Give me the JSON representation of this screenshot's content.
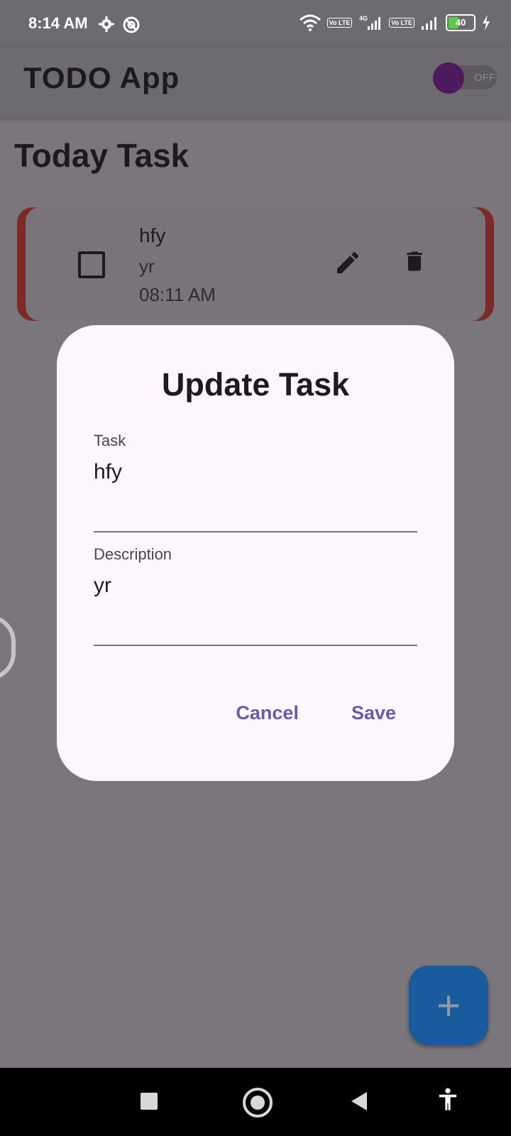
{
  "status_bar": {
    "time": "8:14 AM",
    "icons_left": [
      "gear-icon",
      "target-icon"
    ],
    "network_badge_1": "Vo LTE",
    "network_type": "4G",
    "network_badge_2": "Vo LTE",
    "battery_level": "40",
    "charging_icon": "bolt-icon"
  },
  "app_bar": {
    "title": "TODO App",
    "toggle_label": "OFF",
    "toggle_state": "off"
  },
  "main": {
    "section_title": "Today Task",
    "task": {
      "title": "hfy",
      "description": "yr",
      "time": "08:11 AM",
      "checked": false,
      "accent_color": "#c0392b"
    }
  },
  "dialog": {
    "title": "Update Task",
    "task_label": "Task",
    "task_value": "hfy",
    "description_label": "Description",
    "description_value": "yr",
    "cancel_label": "Cancel",
    "save_label": "Save"
  },
  "fab": {
    "icon": "plus-icon",
    "label": "+"
  },
  "colors": {
    "dialog_bg": "#fdf7fd",
    "button_text": "#6a5aa8",
    "fab": "#1a5b9d",
    "toggle_thumb": "#4e1a5c"
  }
}
